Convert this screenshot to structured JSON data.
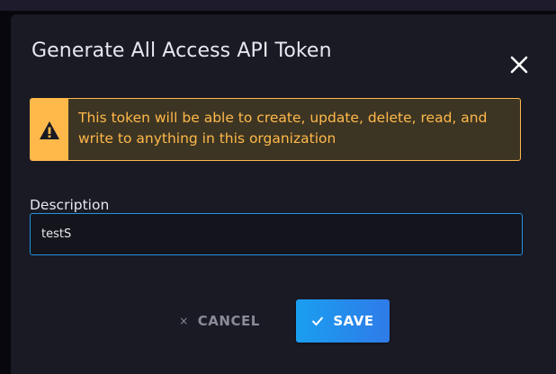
{
  "modal": {
    "title": "Generate All Access API Token",
    "close_icon": "close-icon"
  },
  "alert": {
    "icon": "warning-icon",
    "text": "This token will be able to create, update, delete, read, and write to anything in this organization",
    "color": "#ffb94a"
  },
  "form": {
    "description_label": "Description",
    "description_value": "testS"
  },
  "actions": {
    "cancel_icon": "×",
    "cancel_label": "CANCEL",
    "save_icon": "check-icon",
    "save_label": "SAVE"
  },
  "colors": {
    "accent": "#1a9ef0",
    "warning": "#ffb94a",
    "background": "#1a1a24"
  }
}
